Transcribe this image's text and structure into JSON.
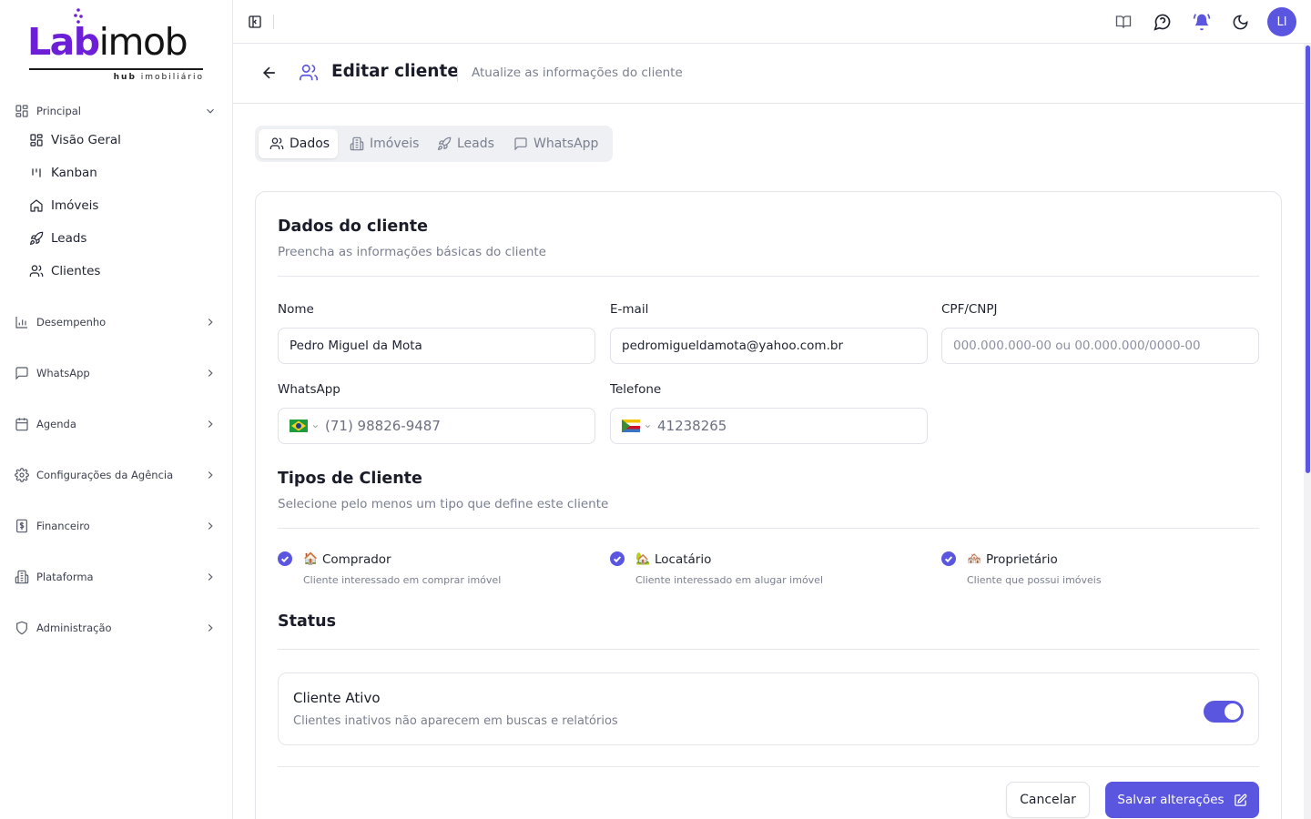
{
  "brand": {
    "logo_text_lab": "Lab",
    "logo_text_imob": "imob",
    "logo_sub_bold": "hub",
    "logo_sub": "imobiliário",
    "accent_color": "#5a56e0",
    "logo_color": "#6c1fd6"
  },
  "sidebar": {
    "principal": {
      "label": "Principal",
      "icon": "layout-grid-icon",
      "items": [
        {
          "label": "Visão Geral",
          "icon": "layout-grid-icon"
        },
        {
          "label": "Kanban",
          "icon": "kanban-icon"
        },
        {
          "label": "Imóveis",
          "icon": "home-icon"
        },
        {
          "label": "Leads",
          "icon": "rocket-icon"
        },
        {
          "label": "Clientes",
          "icon": "users-icon"
        }
      ]
    },
    "sections": [
      {
        "label": "Desempenho",
        "icon": "bar-chart-icon"
      },
      {
        "label": "WhatsApp",
        "icon": "message-square-icon"
      },
      {
        "label": "Agenda",
        "icon": "calendar-icon"
      },
      {
        "label": "Configurações da Agência",
        "icon": "settings-icon"
      },
      {
        "label": "Financeiro",
        "icon": "dollar-receipt-icon"
      },
      {
        "label": "Plataforma",
        "icon": "building-icon"
      },
      {
        "label": "Administração",
        "icon": "shield-icon"
      }
    ]
  },
  "topbar": {
    "avatar_initials": "LI"
  },
  "header": {
    "title": "Editar cliente",
    "subtitle": "Atualize as informações do cliente"
  },
  "tabs": [
    {
      "label": "Dados",
      "icon": "users-icon",
      "active": true
    },
    {
      "label": "Imóveis",
      "icon": "building-icon",
      "active": false
    },
    {
      "label": "Leads",
      "icon": "rocket-icon",
      "active": false
    },
    {
      "label": "WhatsApp",
      "icon": "message-square-icon",
      "active": false
    }
  ],
  "form": {
    "title": "Dados do cliente",
    "subtitle": "Preencha as informações básicas do cliente",
    "nome": {
      "label": "Nome",
      "value": "Pedro Miguel da Mota"
    },
    "email": {
      "label": "E-mail",
      "value": "pedromigueldamota@yahoo.com.br"
    },
    "cpf": {
      "label": "CPF/CNPJ",
      "value": "",
      "placeholder": "000.000.000-00 ou 00.000.000/0000-00"
    },
    "whatsapp": {
      "label": "WhatsApp",
      "value": "(71) 98826-9487",
      "flag": "brazil-flag-icon"
    },
    "telefone": {
      "label": "Telefone",
      "value": "41238265",
      "flag": "comoros-flag-icon"
    }
  },
  "tipos": {
    "title": "Tipos de Cliente",
    "subtitle": "Selecione pelo menos um tipo que define este cliente",
    "options": [
      {
        "emoji": "🏠",
        "label": "Comprador",
        "desc": "Cliente interessado em comprar imóvel",
        "checked": true
      },
      {
        "emoji": "🏡",
        "label": "Locatário",
        "desc": "Cliente interessado em alugar imóvel",
        "checked": true
      },
      {
        "emoji": "🏘️",
        "label": "Proprietário",
        "desc": "Cliente que possui imóveis",
        "checked": true
      }
    ]
  },
  "status": {
    "title": "Status",
    "active_title": "Cliente Ativo",
    "active_desc": "Clientes inativos não aparecem em buscas e relatórios",
    "active": true
  },
  "actions": {
    "cancel": "Cancelar",
    "save": "Salvar alterações"
  }
}
